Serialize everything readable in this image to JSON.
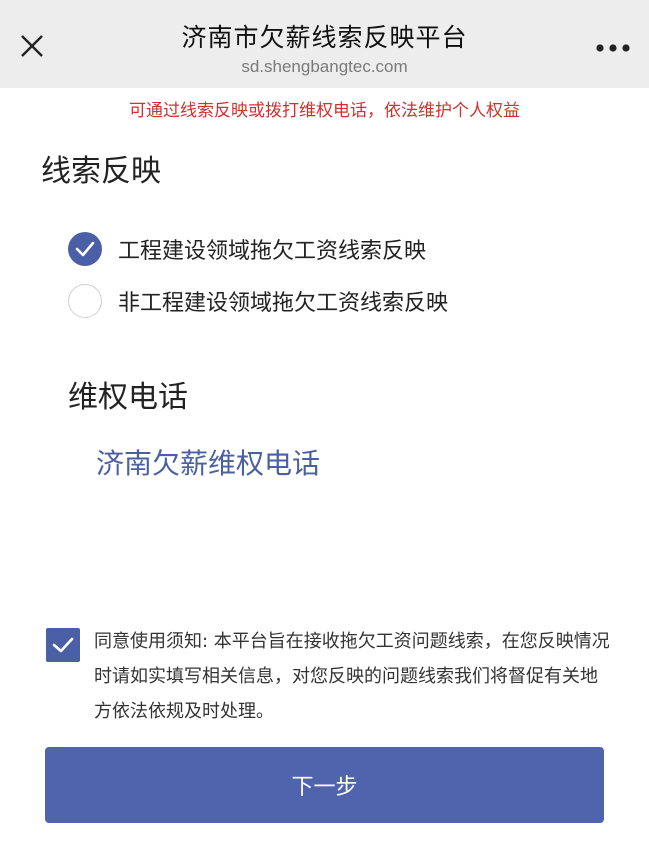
{
  "header": {
    "title": "济南市欠薪线索反映平台",
    "domain": "sd.shengbangtec.com"
  },
  "notice": "可通过线索反映或拨打维权电话，依法维护个人权益",
  "section_report": {
    "title": "线索反映",
    "options": [
      {
        "label": "工程建设领域拖欠工资线索反映",
        "selected": true
      },
      {
        "label": "非工程建设领域拖欠工资线索反映",
        "selected": false
      }
    ]
  },
  "section_hotline": {
    "title": "维权电话",
    "link": "济南欠薪维权电话"
  },
  "agreement": {
    "checked": true,
    "text": "同意使用须知: 本平台旨在接收拖欠工资问题线索，在您反映情况时请如实填写相关信息，对您反映的问题线索我们将督促有关地方依法依规及时处理。"
  },
  "next_button": "下一步",
  "colors": {
    "accent": "#4a5fa5",
    "notice": "#d0312d",
    "topbar": "#ededed"
  }
}
